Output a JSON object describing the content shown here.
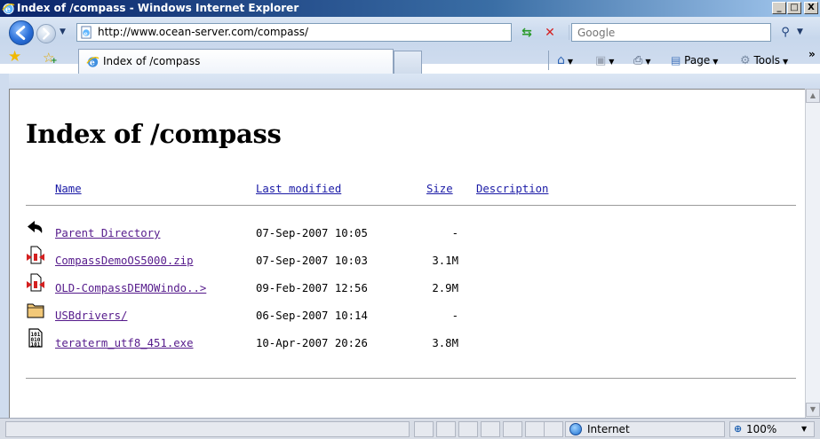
{
  "window": {
    "title": "Index of /compass - Windows Internet Explorer",
    "controls": {
      "minimize": "_",
      "maximize": "□",
      "close": "X"
    }
  },
  "navbar": {
    "address_url": "http://www.ocean-server.com/compass/",
    "search_placeholder": "Google"
  },
  "tabs": [
    {
      "label": "Index of /compass",
      "active": true
    }
  ],
  "commandbar": {
    "page_label": "Page",
    "tools_label": "Tools"
  },
  "listing": {
    "heading": "Index of /compass",
    "columns": {
      "name": "Name",
      "last_modified": "Last modified",
      "size": "Size",
      "description": "Description"
    },
    "rows": [
      {
        "icon": "back-arrow-icon",
        "name": "Parent Directory",
        "modified": "07-Sep-2007 10:05",
        "size": "-"
      },
      {
        "icon": "compressed-file-icon",
        "name": "CompassDemoOS5000.zip",
        "modified": "07-Sep-2007 10:03",
        "size": "3.1M"
      },
      {
        "icon": "compressed-file-icon",
        "name": "OLD-CompassDEMOWindo..>",
        "modified": "09-Feb-2007 12:56",
        "size": "2.9M"
      },
      {
        "icon": "folder-icon",
        "name": "USBdrivers/",
        "modified": "06-Sep-2007 10:14",
        "size": "-"
      },
      {
        "icon": "binary-file-icon",
        "name": "teraterm_utf8_451.exe",
        "modified": "10-Apr-2007 20:26",
        "size": "3.8M"
      }
    ]
  },
  "statusbar": {
    "zone": "Internet",
    "zoom": "100%"
  },
  "colors": {
    "link": "#1a1aa6",
    "visited_link": "#551a8b",
    "titlebar": "#0a246a",
    "chrome": "#cfdcee"
  }
}
